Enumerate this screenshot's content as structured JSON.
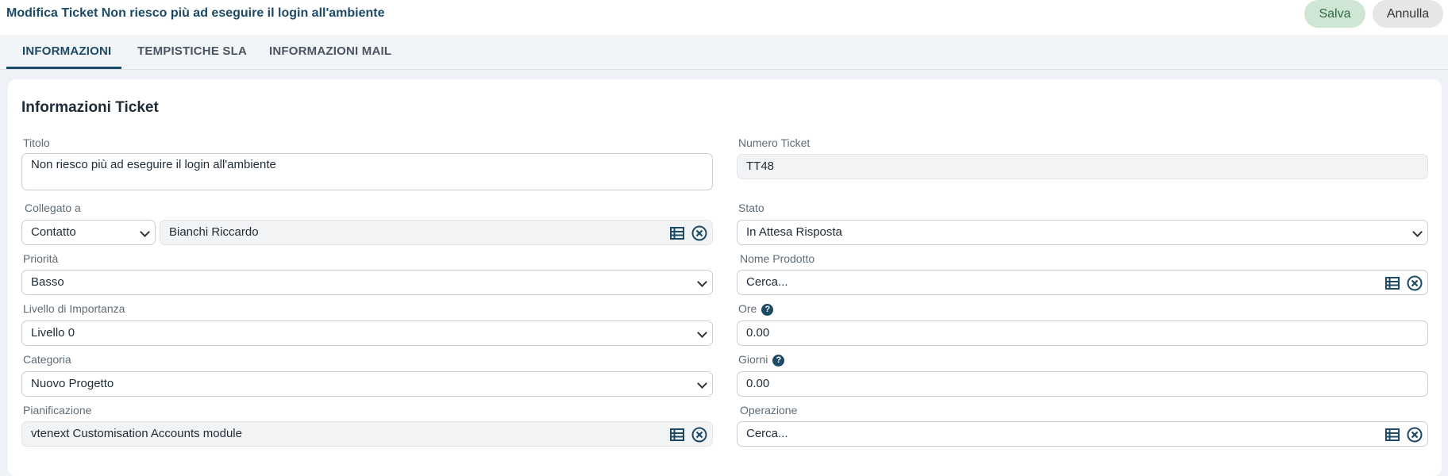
{
  "header": {
    "title": "Modifica Ticket Non riesco più ad eseguire il login all'ambiente",
    "save_label": "Salva",
    "cancel_label": "Annulla"
  },
  "tabs": [
    {
      "label": "INFORMAZIONI",
      "active": true
    },
    {
      "label": "TEMPISTICHE SLA",
      "active": false
    },
    {
      "label": "INFORMAZIONI MAIL",
      "active": false
    }
  ],
  "section": {
    "title": "Informazioni Ticket"
  },
  "fields": {
    "titolo": {
      "label": "Titolo",
      "value": "Non riesco più ad eseguire il login all'ambiente"
    },
    "numero_ticket": {
      "label": "Numero Ticket",
      "value": "TT48"
    },
    "collegato_a": {
      "label": "Collegato a",
      "type_value": "Contatto",
      "value": "Bianchi Riccardo"
    },
    "stato": {
      "label": "Stato",
      "value": "In Attesa Risposta"
    },
    "priorita": {
      "label": "Priorità",
      "value": "Basso"
    },
    "nome_prodotto": {
      "label": "Nome Prodotto",
      "placeholder": "Cerca..."
    },
    "livello_importanza": {
      "label": "Livello di Importanza",
      "value": "Livello 0"
    },
    "ore": {
      "label": "Ore",
      "value": "0.00",
      "help": "?"
    },
    "categoria": {
      "label": "Categoria",
      "value": "Nuovo Progetto"
    },
    "giorni": {
      "label": "Giorni",
      "value": "0.00",
      "help": "?"
    },
    "pianificazione": {
      "label": "Pianificazione",
      "value": "vtenext Customisation Accounts module"
    },
    "operazione": {
      "label": "Operazione",
      "placeholder": "Cerca..."
    }
  },
  "colors": {
    "accent": "#1c4a66",
    "save_bg": "#cfe6d4",
    "cancel_bg": "#e4e6e8"
  },
  "icons": {
    "list": "list-icon",
    "clear": "clear-circle-icon"
  }
}
